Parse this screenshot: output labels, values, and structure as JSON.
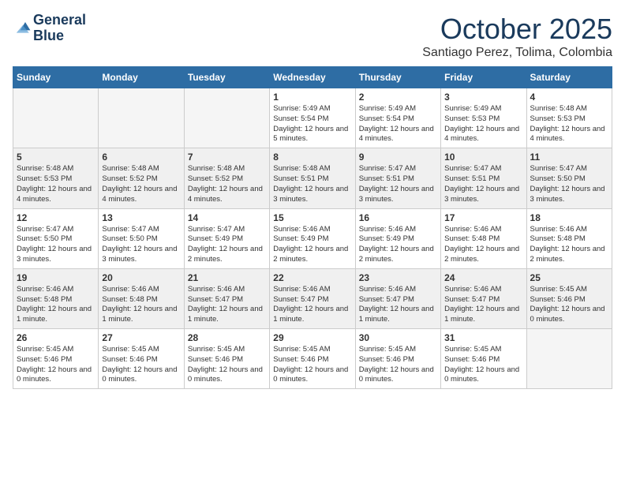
{
  "logo": {
    "line1": "General",
    "line2": "Blue"
  },
  "title": "October 2025",
  "location": "Santiago Perez, Tolima, Colombia",
  "weekdays": [
    "Sunday",
    "Monday",
    "Tuesday",
    "Wednesday",
    "Thursday",
    "Friday",
    "Saturday"
  ],
  "weeks": [
    [
      {
        "date": "",
        "info": ""
      },
      {
        "date": "",
        "info": ""
      },
      {
        "date": "",
        "info": ""
      },
      {
        "date": "1",
        "info": "Sunrise: 5:49 AM\nSunset: 5:54 PM\nDaylight: 12 hours\nand 5 minutes."
      },
      {
        "date": "2",
        "info": "Sunrise: 5:49 AM\nSunset: 5:54 PM\nDaylight: 12 hours\nand 4 minutes."
      },
      {
        "date": "3",
        "info": "Sunrise: 5:49 AM\nSunset: 5:53 PM\nDaylight: 12 hours\nand 4 minutes."
      },
      {
        "date": "4",
        "info": "Sunrise: 5:48 AM\nSunset: 5:53 PM\nDaylight: 12 hours\nand 4 minutes."
      }
    ],
    [
      {
        "date": "5",
        "info": "Sunrise: 5:48 AM\nSunset: 5:53 PM\nDaylight: 12 hours\nand 4 minutes."
      },
      {
        "date": "6",
        "info": "Sunrise: 5:48 AM\nSunset: 5:52 PM\nDaylight: 12 hours\nand 4 minutes."
      },
      {
        "date": "7",
        "info": "Sunrise: 5:48 AM\nSunset: 5:52 PM\nDaylight: 12 hours\nand 4 minutes."
      },
      {
        "date": "8",
        "info": "Sunrise: 5:48 AM\nSunset: 5:51 PM\nDaylight: 12 hours\nand 3 minutes."
      },
      {
        "date": "9",
        "info": "Sunrise: 5:47 AM\nSunset: 5:51 PM\nDaylight: 12 hours\nand 3 minutes."
      },
      {
        "date": "10",
        "info": "Sunrise: 5:47 AM\nSunset: 5:51 PM\nDaylight: 12 hours\nand 3 minutes."
      },
      {
        "date": "11",
        "info": "Sunrise: 5:47 AM\nSunset: 5:50 PM\nDaylight: 12 hours\nand 3 minutes."
      }
    ],
    [
      {
        "date": "12",
        "info": "Sunrise: 5:47 AM\nSunset: 5:50 PM\nDaylight: 12 hours\nand 3 minutes."
      },
      {
        "date": "13",
        "info": "Sunrise: 5:47 AM\nSunset: 5:50 PM\nDaylight: 12 hours\nand 3 minutes."
      },
      {
        "date": "14",
        "info": "Sunrise: 5:47 AM\nSunset: 5:49 PM\nDaylight: 12 hours\nand 2 minutes."
      },
      {
        "date": "15",
        "info": "Sunrise: 5:46 AM\nSunset: 5:49 PM\nDaylight: 12 hours\nand 2 minutes."
      },
      {
        "date": "16",
        "info": "Sunrise: 5:46 AM\nSunset: 5:49 PM\nDaylight: 12 hours\nand 2 minutes."
      },
      {
        "date": "17",
        "info": "Sunrise: 5:46 AM\nSunset: 5:48 PM\nDaylight: 12 hours\nand 2 minutes."
      },
      {
        "date": "18",
        "info": "Sunrise: 5:46 AM\nSunset: 5:48 PM\nDaylight: 12 hours\nand 2 minutes."
      }
    ],
    [
      {
        "date": "19",
        "info": "Sunrise: 5:46 AM\nSunset: 5:48 PM\nDaylight: 12 hours\nand 1 minute."
      },
      {
        "date": "20",
        "info": "Sunrise: 5:46 AM\nSunset: 5:48 PM\nDaylight: 12 hours\nand 1 minute."
      },
      {
        "date": "21",
        "info": "Sunrise: 5:46 AM\nSunset: 5:47 PM\nDaylight: 12 hours\nand 1 minute."
      },
      {
        "date": "22",
        "info": "Sunrise: 5:46 AM\nSunset: 5:47 PM\nDaylight: 12 hours\nand 1 minute."
      },
      {
        "date": "23",
        "info": "Sunrise: 5:46 AM\nSunset: 5:47 PM\nDaylight: 12 hours\nand 1 minute."
      },
      {
        "date": "24",
        "info": "Sunrise: 5:46 AM\nSunset: 5:47 PM\nDaylight: 12 hours\nand 1 minute."
      },
      {
        "date": "25",
        "info": "Sunrise: 5:45 AM\nSunset: 5:46 PM\nDaylight: 12 hours\nand 0 minutes."
      }
    ],
    [
      {
        "date": "26",
        "info": "Sunrise: 5:45 AM\nSunset: 5:46 PM\nDaylight: 12 hours\nand 0 minutes."
      },
      {
        "date": "27",
        "info": "Sunrise: 5:45 AM\nSunset: 5:46 PM\nDaylight: 12 hours\nand 0 minutes."
      },
      {
        "date": "28",
        "info": "Sunrise: 5:45 AM\nSunset: 5:46 PM\nDaylight: 12 hours\nand 0 minutes."
      },
      {
        "date": "29",
        "info": "Sunrise: 5:45 AM\nSunset: 5:46 PM\nDaylight: 12 hours\nand 0 minutes."
      },
      {
        "date": "30",
        "info": "Sunrise: 5:45 AM\nSunset: 5:46 PM\nDaylight: 12 hours\nand 0 minutes."
      },
      {
        "date": "31",
        "info": "Sunrise: 5:45 AM\nSunset: 5:46 PM\nDaylight: 12 hours\nand 0 minutes."
      },
      {
        "date": "",
        "info": ""
      }
    ]
  ]
}
